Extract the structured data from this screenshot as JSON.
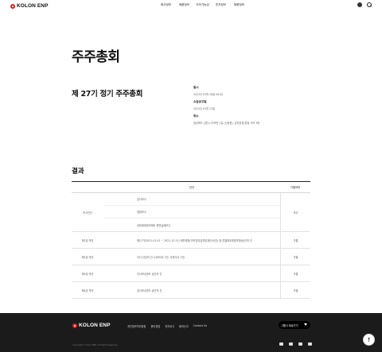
{
  "header": {
    "logo": "KOLON ENP",
    "nav": [
      "회사정보",
      "제품정보",
      "지속가능성",
      "투자정보",
      "채용정보"
    ],
    "icons": [
      "globe-icon",
      "search-icon"
    ]
  },
  "page": {
    "title": "주주총회",
    "meeting_title": "제 27기 정기 주주총회",
    "info": [
      {
        "label": "일시",
        "value": "2022년 03월 28일 09:00"
      },
      {
        "label": "소집공고일",
        "value": "2022년 03월 13일"
      },
      {
        "label": "장소",
        "value": "경상북도 김천시 어모면 1길 (신동원), 김천공장/본점 사옥 3층"
      }
    ],
    "result_title": "결과"
  },
  "table": {
    "headers": [
      "안건",
      "가결여부"
    ],
    "groups": [
      {
        "category": "보고안건",
        "items": [
          "감사보고",
          "영업보고",
          "내부회계관리제도 운영실태보고"
        ],
        "result": "보고"
      },
      {
        "category": "제1호 의안",
        "items": [
          "제27기(2021.01.01 ~ 2021.12.31) 재무제표(이익잉여금처분계산서(안) 및 연결재무제표포함)승인의 건"
        ],
        "result": "가결"
      },
      {
        "category": "제2호 의안",
        "items": [
          "이사 선임의 건 (사내이사 2인, 사외이사 1인)"
        ],
        "result": "가결"
      },
      {
        "category": "제3호 의안",
        "items": [
          "이사보수한도 승인의 건"
        ],
        "result": "가결"
      },
      {
        "category": "제4호 의안",
        "items": [
          "감사보수한도 승인의 건"
        ],
        "result": "가결"
      }
    ]
  },
  "footer": {
    "logo": "KOLON ENP",
    "links": [
      "개인정보처리방침",
      "윤리경영",
      "전자공고",
      "윤리신고",
      "Contact Us"
    ],
    "family_site": "그룹사 바로가기",
    "copyright": "Copyright © Kolon ENP. All Rights Reserved.",
    "sns": [
      "youtube-icon",
      "instagram-icon",
      "facebook-icon",
      "blog-icon"
    ],
    "top_button": "↑"
  },
  "colors": {
    "brand": "#e0201b",
    "footer_bg": "#1b1b1b"
  }
}
